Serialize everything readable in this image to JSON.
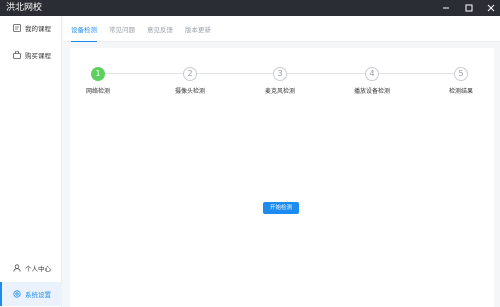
{
  "window": {
    "title": "洪北网校"
  },
  "sidebar": {
    "items": [
      {
        "label": "我的课程",
        "icon": "course-icon"
      },
      {
        "label": "购买课程",
        "icon": "bag-icon"
      }
    ],
    "bottom_items": [
      {
        "label": "个人中心",
        "icon": "user-icon"
      },
      {
        "label": "系统设置",
        "icon": "settings-icon",
        "active": true
      }
    ]
  },
  "tabs": [
    {
      "label": "设备检测",
      "active": true
    },
    {
      "label": "常见问题"
    },
    {
      "label": "意见反馈"
    },
    {
      "label": "版本更新"
    }
  ],
  "steps": [
    {
      "num": "1",
      "label": "网络检测",
      "done": true
    },
    {
      "num": "2",
      "label": "摄像头检测"
    },
    {
      "num": "3",
      "label": "麦克风检测"
    },
    {
      "num": "4",
      "label": "播放设备检测"
    },
    {
      "num": "5",
      "label": "检测结果"
    }
  ],
  "start_button": {
    "label": "开始检测"
  },
  "colors": {
    "accent": "#1d8cf0",
    "done": "#5ed05e",
    "titlebar": "#2a2d33"
  }
}
